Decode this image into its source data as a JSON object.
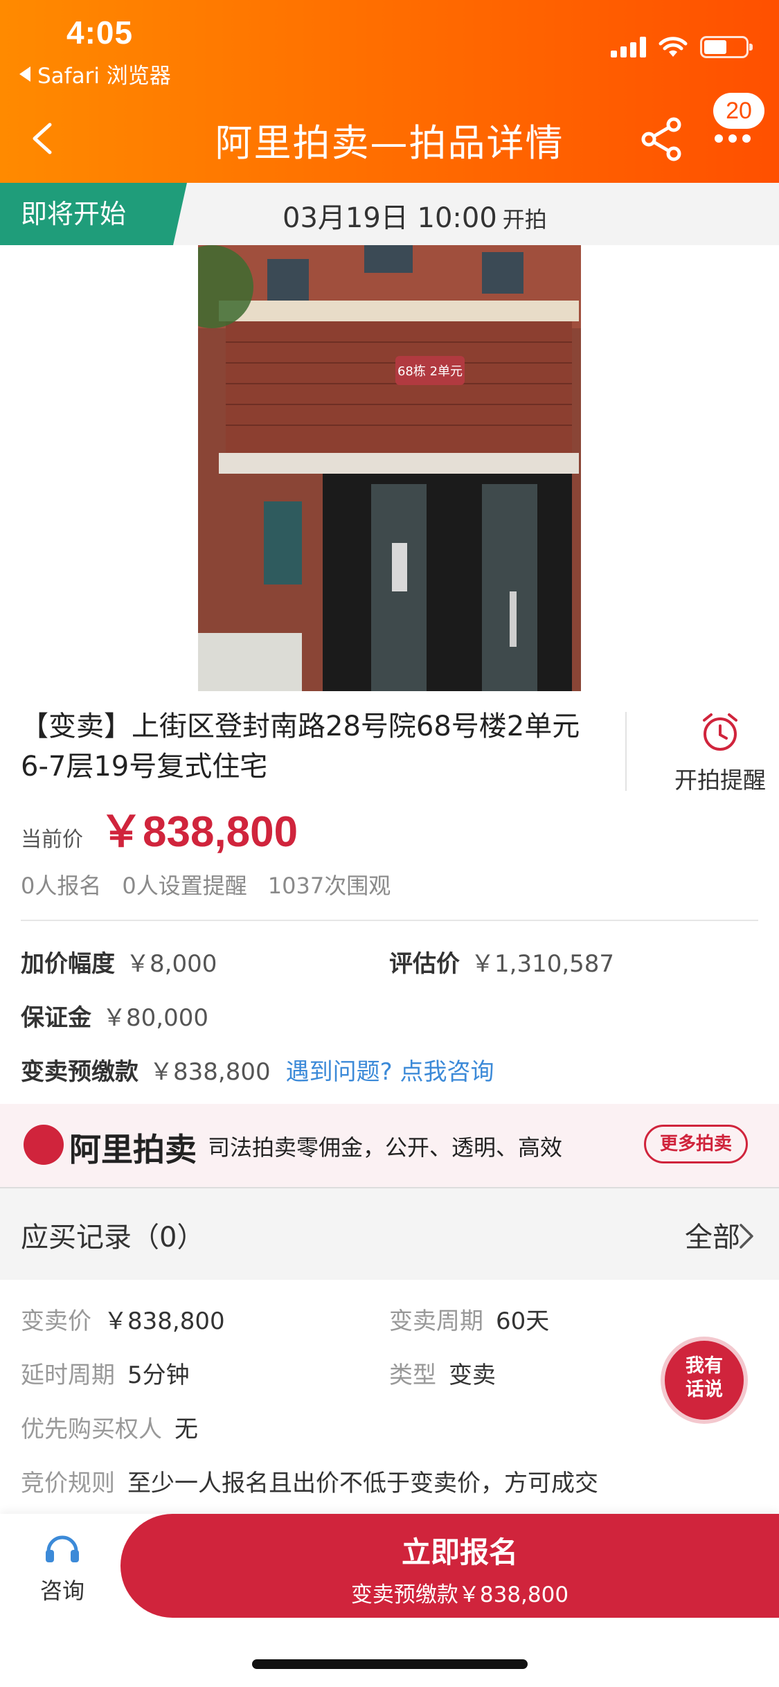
{
  "status": {
    "time": "4:05",
    "back_app": "Safari 浏览器"
  },
  "nav": {
    "title": "阿里拍卖—拍品详情",
    "badge": "20"
  },
  "countdown": {
    "tag": "即将开始",
    "start_time": "03月19日 10:00",
    "start_suffix": "开拍"
  },
  "item": {
    "title": "【变卖】上街区登封南路28号院68号楼2单元6-7层19号复式住宅",
    "remind_label": "开拍提醒",
    "price_label": "当前价",
    "price_value": "￥838,800",
    "stats": [
      "0人报名",
      "0人设置提醒",
      "1037次围观"
    ]
  },
  "details": {
    "increment_label": "加价幅度",
    "increment_value": "￥8,000",
    "appraisal_label": "评估价",
    "appraisal_value": "￥1,310,587",
    "deposit_label": "保证金",
    "deposit_value": "￥80,000",
    "prepay_label": "变卖预缴款",
    "prepay_value": "￥838,800",
    "help_link": "遇到问题? 点我咨询"
  },
  "banner": {
    "logo_text": "阿里拍卖",
    "slogan": "司法拍卖零佣金，公开、透明、高效",
    "more_button": "更多拍卖"
  },
  "records": {
    "label": "应买记录（0）",
    "all": "全部"
  },
  "info": {
    "sale_price_label": "变卖价",
    "sale_price_value": "￥838,800",
    "sale_period_label": "变卖周期",
    "sale_period_value": "60天",
    "delay_label": "延时周期",
    "delay_value": "5分钟",
    "type_label": "类型",
    "type_value": "变卖",
    "priority_label": "优先购买权人",
    "priority_value": "无",
    "rule_label": "竞价规则",
    "rule_value": "至少一人报名且出价不低于变卖价，方可成交"
  },
  "fab": {
    "line1": "我有",
    "line2": "话说"
  },
  "bottom": {
    "consult_label": "咨询",
    "cta_main": "立即报名",
    "cta_sub": "变卖预缴款￥838,800"
  },
  "colors": {
    "header_orange": "#ff6a00",
    "accent_red": "#d0243c",
    "tag_green": "#1f9d7a",
    "link_blue": "#3c8ad8"
  }
}
